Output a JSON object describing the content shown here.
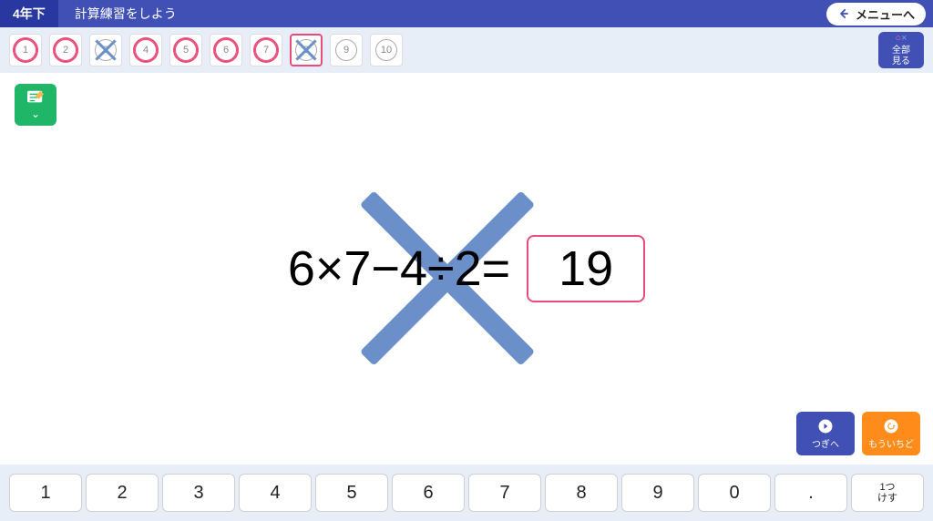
{
  "header": {
    "grade": "4年下",
    "title": "計算練習をしよう",
    "menu": "メニューへ"
  },
  "questions": [
    {
      "num": "1",
      "status": "correct"
    },
    {
      "num": "2",
      "status": "correct"
    },
    {
      "num": "3",
      "status": "wrong"
    },
    {
      "num": "4",
      "status": "correct"
    },
    {
      "num": "5",
      "status": "correct"
    },
    {
      "num": "6",
      "status": "correct"
    },
    {
      "num": "7",
      "status": "correct"
    },
    {
      "num": "8",
      "status": "wrong",
      "current": true
    },
    {
      "num": "9",
      "status": "none"
    },
    {
      "num": "10",
      "status": "none"
    }
  ],
  "view_all": {
    "line1": "全部",
    "line2": "見る"
  },
  "problem": {
    "expression": "6×7−4÷2=",
    "answer": "19",
    "result": "wrong"
  },
  "actions": {
    "next": "つぎへ",
    "retry": "もういちど"
  },
  "keypad": [
    "1",
    "2",
    "3",
    "4",
    "5",
    "6",
    "7",
    "8",
    "9",
    "0",
    "."
  ],
  "keypad_special": "1つ\nけす"
}
